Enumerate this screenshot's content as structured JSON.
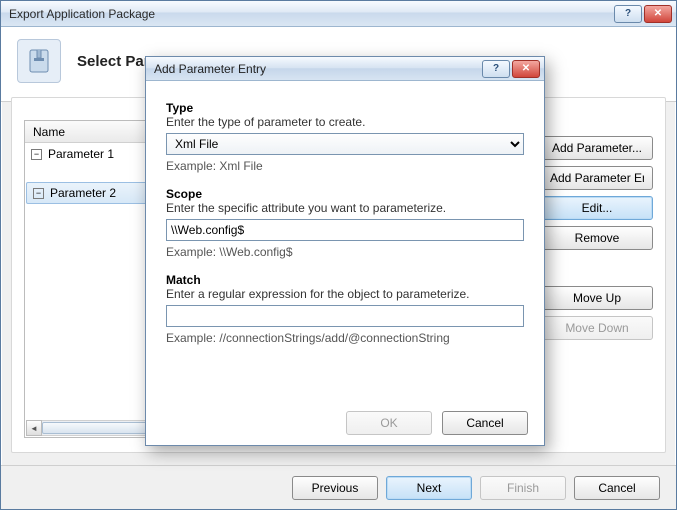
{
  "wizard": {
    "title": "Export Application Package",
    "heading": "Select Parameters"
  },
  "grid": {
    "header": "Name",
    "rows": [
      "Parameter 1",
      "Parameter 2"
    ],
    "selected_index": 1
  },
  "side": {
    "add_param": "Add Parameter...",
    "add_entry": "Add Parameter Entry...",
    "edit": "Edit...",
    "remove": "Remove",
    "move_up": "Move Up",
    "move_down": "Move Down"
  },
  "wizard_buttons": {
    "previous": "Previous",
    "next": "Next",
    "finish": "Finish",
    "cancel": "Cancel"
  },
  "dialog": {
    "title": "Add Parameter Entry",
    "type_label": "Type",
    "type_hint": "Enter the type of parameter to create.",
    "type_value": "Xml File",
    "type_example": "Example: Xml File",
    "scope_label": "Scope",
    "scope_hint": "Enter the specific attribute you want to parameterize.",
    "scope_value": "\\\\Web.config$",
    "scope_example": "Example: \\\\Web.config$",
    "match_label": "Match",
    "match_hint": "Enter a regular expression for the object to parameterize.",
    "match_value": "",
    "match_example": "Example: //connectionStrings/add/@connectionString",
    "ok": "OK",
    "cancel": "Cancel"
  }
}
